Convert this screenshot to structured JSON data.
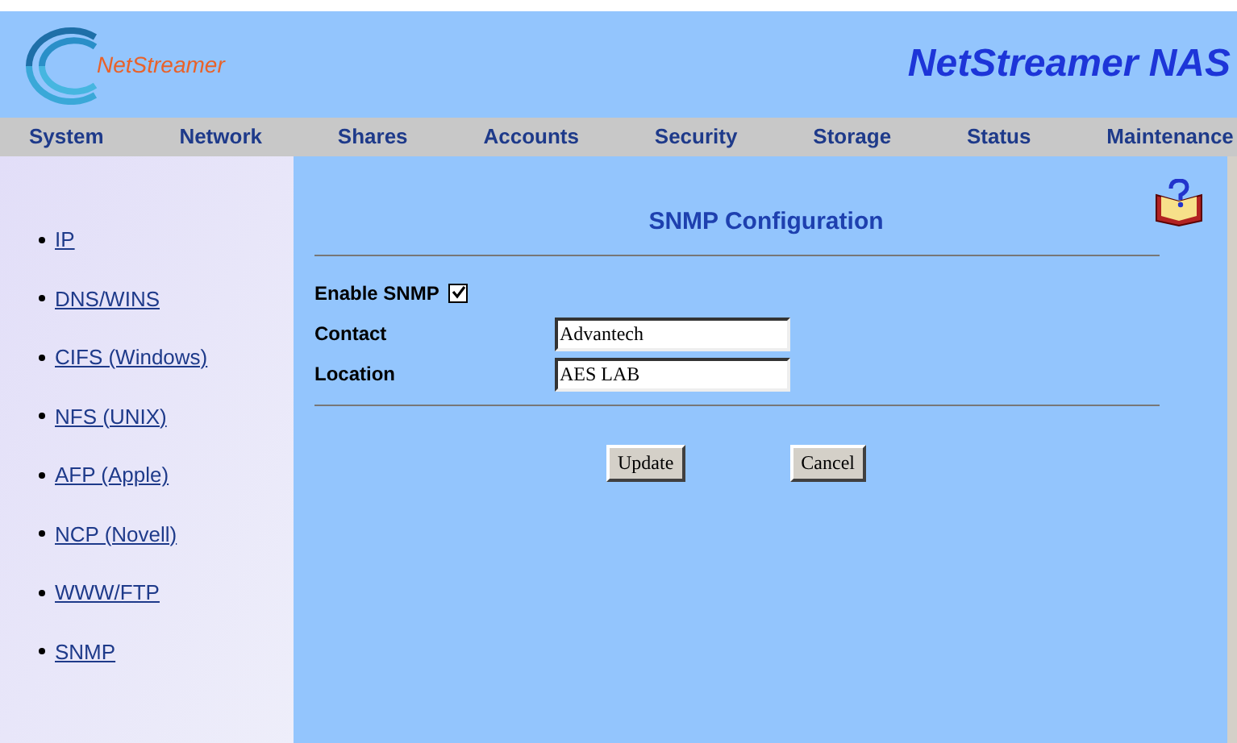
{
  "header": {
    "logo_text": "NetStreamer",
    "title": "NetStreamer NAS"
  },
  "nav": [
    {
      "label": "System"
    },
    {
      "label": "Network"
    },
    {
      "label": "Shares"
    },
    {
      "label": "Accounts"
    },
    {
      "label": "Security"
    },
    {
      "label": "Storage"
    },
    {
      "label": "Status"
    },
    {
      "label": "Maintenance"
    }
  ],
  "sidebar": {
    "items": [
      {
        "label": "IP"
      },
      {
        "label": "DNS/WINS"
      },
      {
        "label": "CIFS (Windows)"
      },
      {
        "label": "NFS (UNIX)"
      },
      {
        "label": "AFP (Apple)"
      },
      {
        "label": "NCP (Novell)"
      },
      {
        "label": "WWW/FTP"
      },
      {
        "label": "SNMP"
      }
    ]
  },
  "form": {
    "title": "SNMP Configuration",
    "enable": {
      "label": "Enable SNMP",
      "checked": true
    },
    "fields": [
      {
        "label": "Contact",
        "value": "Advantech"
      },
      {
        "label": "Location",
        "value": "AES LAB"
      }
    ],
    "buttons": [
      "Update",
      "Cancel"
    ]
  }
}
